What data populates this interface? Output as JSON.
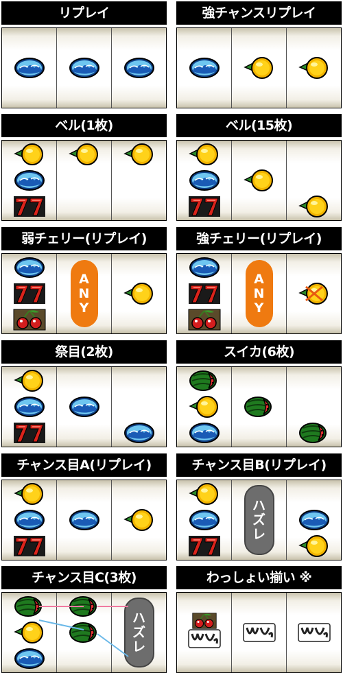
{
  "panels": [
    {
      "title": "リプレイ"
    },
    {
      "title": "強チャンスリプレイ"
    },
    {
      "title": "ベル(1枚)"
    },
    {
      "title": "ベル(15枚)"
    },
    {
      "title": "弱チェリー(リプレイ)"
    },
    {
      "title": "強チェリー(リプレイ)"
    },
    {
      "title": "祭目(2枚)"
    },
    {
      "title": "スイカ(6枚)"
    },
    {
      "title": "チャンス目A(リプレイ)"
    },
    {
      "title": "チャンス目B(リプレイ)"
    },
    {
      "title": "チャンス目C(3枚)"
    },
    {
      "title": "わっしょい揃い ※"
    }
  ],
  "labels": {
    "any": [
      "A",
      "N",
      "Y"
    ],
    "hazure": [
      "ハ",
      "ズ",
      "レ"
    ]
  },
  "logo_text": "わっしょい"
}
